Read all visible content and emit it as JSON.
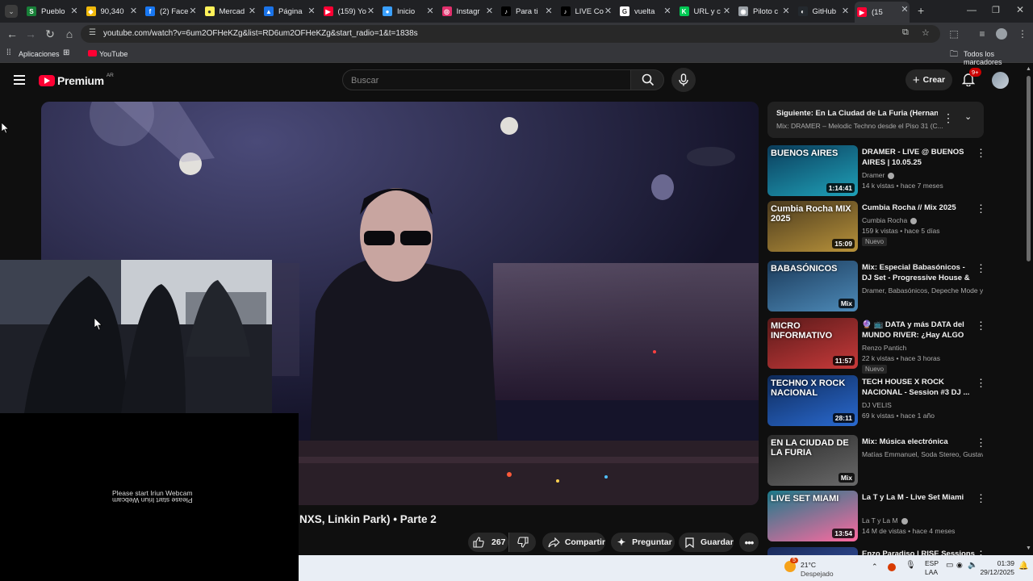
{
  "browser": {
    "tabs": [
      {
        "label": "Pueblo",
        "color": "#188038",
        "glyph": "S"
      },
      {
        "label": "90,340",
        "color": "#f0b90b",
        "glyph": "◆"
      },
      {
        "label": "(2) Face",
        "color": "#1877f2",
        "glyph": "f"
      },
      {
        "label": "Mercad",
        "color": "#fff159",
        "glyph": "●"
      },
      {
        "label": "Página",
        "color": "#1a73e8",
        "glyph": "▲"
      },
      {
        "label": "(159) Yo",
        "color": "#ff0033",
        "glyph": "▶"
      },
      {
        "label": "Inicio",
        "color": "#3aa0ff",
        "glyph": "●"
      },
      {
        "label": "Instagr",
        "color": "#e1306c",
        "glyph": "◎"
      },
      {
        "label": "Para ti",
        "color": "#000000",
        "glyph": "♪"
      },
      {
        "label": "LIVE Co",
        "color": "#000000",
        "glyph": "♪"
      },
      {
        "label": "vuelta",
        "color": "#ffffff",
        "glyph": "G"
      },
      {
        "label": "URL y c",
        "color": "#00c853",
        "glyph": "K"
      },
      {
        "label": "Piloto c",
        "color": "#9aa0a6",
        "glyph": "◉"
      },
      {
        "label": "GitHub",
        "color": "#24292e",
        "glyph": "◐"
      },
      {
        "label": "(15",
        "color": "#ff0033",
        "glyph": "▶"
      }
    ],
    "url": "youtube.com/watch?v=6um2OFHeKZg&list=RD6um2OFHeKZg&start_radio=1&t=1838s",
    "bookmarks": {
      "apps": "Aplicaciones",
      "youtube": "YouTube",
      "all": "Todos los marcadores"
    }
  },
  "youtube": {
    "logo": "Premium",
    "region": "AR",
    "search_placeholder": "Buscar",
    "create_label": "Crear",
    "notif_count": "9+",
    "overlay_webcam_text": "Please start Iriun Webcam",
    "overlay_webcam_mirror": "Please start Iriun Webcam",
    "video_title_partial": "NXS, Linkin Park) • Parte 2",
    "likes": "267",
    "share": "Compartir",
    "ask": "Preguntar",
    "save": "Guardar",
    "queue": {
      "title": "Siguiente: En La Ciudad de La Furia (Hernan ...",
      "subtitle": "Mix: DRAMER – Melodic Techno desde el Piso 31 (C..."
    },
    "recs": [
      {
        "title": "DRAMER - LIVE @ BUENOS AIRES | 10.05.25",
        "channel": "Dramer",
        "verified": true,
        "meta": "14 k vistas • hace 7 meses",
        "dur": "1:14:41",
        "badge": "",
        "thumb_text": "BUENOS AIRES",
        "colors": [
          "#0b3d5c",
          "#1fa1b8"
        ]
      },
      {
        "title": "Cumbia Rocha // Mix 2025",
        "channel": "Cumbia Rocha",
        "verified": true,
        "meta": "159 k vistas • hace 5 días",
        "dur": "15:09",
        "badge": "Nuevo",
        "thumb_text": "Cumbia Rocha MIX 2025",
        "colors": [
          "#4a3a1e",
          "#b8923a"
        ]
      },
      {
        "title": "Mix: Especial Babasónicos - DJ Set - Progressive House & ...",
        "channel": "Dramer, Babasónicos, Depeche Mode y ...",
        "verified": false,
        "meta": "",
        "dur": "Mix",
        "badge": "",
        "thumb_text": "BABASÓNICOS",
        "colors": [
          "#1b3a5a",
          "#4d8ab8"
        ]
      },
      {
        "title": "🔮 📺 DATA y más DATA del MUNDO RIVER: ¿Hay ALGO po...",
        "channel": "Renzo Pantich",
        "verified": false,
        "meta": "22 k vistas • hace 3 horas",
        "dur": "11:57",
        "badge": "Nuevo",
        "thumb_text": "MICRO INFORMATIVO",
        "colors": [
          "#5a1a1a",
          "#c83a3a"
        ]
      },
      {
        "title": "TECH HOUSE X ROCK NACIONAL - Session #3 DJ ...",
        "channel": "DJ VELIS",
        "verified": false,
        "meta": "69 k vistas • hace 1 año",
        "dur": "28:11",
        "badge": "",
        "thumb_text": "TECHNO X ROCK NACIONAL",
        "colors": [
          "#0e2a5a",
          "#2a6ad0"
        ]
      },
      {
        "title": "Mix: Música electrónica",
        "channel": "Matías Emmanuel, Soda Stereo, Gustavo...",
        "verified": false,
        "meta": "",
        "dur": "Mix",
        "badge": "",
        "thumb_text": "EN LA CIUDAD DE LA FURIA",
        "colors": [
          "#2a2a2a",
          "#6a6a6a"
        ]
      },
      {
        "title": "La T y La M - Live Set Miami",
        "channel": "La T y La M",
        "verified": true,
        "meta": "14 M de vistas • hace 4 meses",
        "dur": "13:54",
        "badge": "",
        "thumb_text": "LIVE SET MIAMI",
        "colors": [
          "#1a7a8a",
          "#ff6aa0"
        ]
      },
      {
        "title": "Enzo Paradiso | RISE Sessions",
        "channel": "",
        "verified": false,
        "meta": "",
        "dur": "",
        "badge": "",
        "thumb_text": "",
        "colors": [
          "#1a2a5a",
          "#3a5ab0"
        ]
      }
    ]
  },
  "taskbar": {
    "temp": "21°C",
    "weather": "Despejado",
    "weather_badge": "5",
    "lang": "ESP",
    "layout": "LAA",
    "time": "01:39",
    "date": "29/12/2025"
  }
}
